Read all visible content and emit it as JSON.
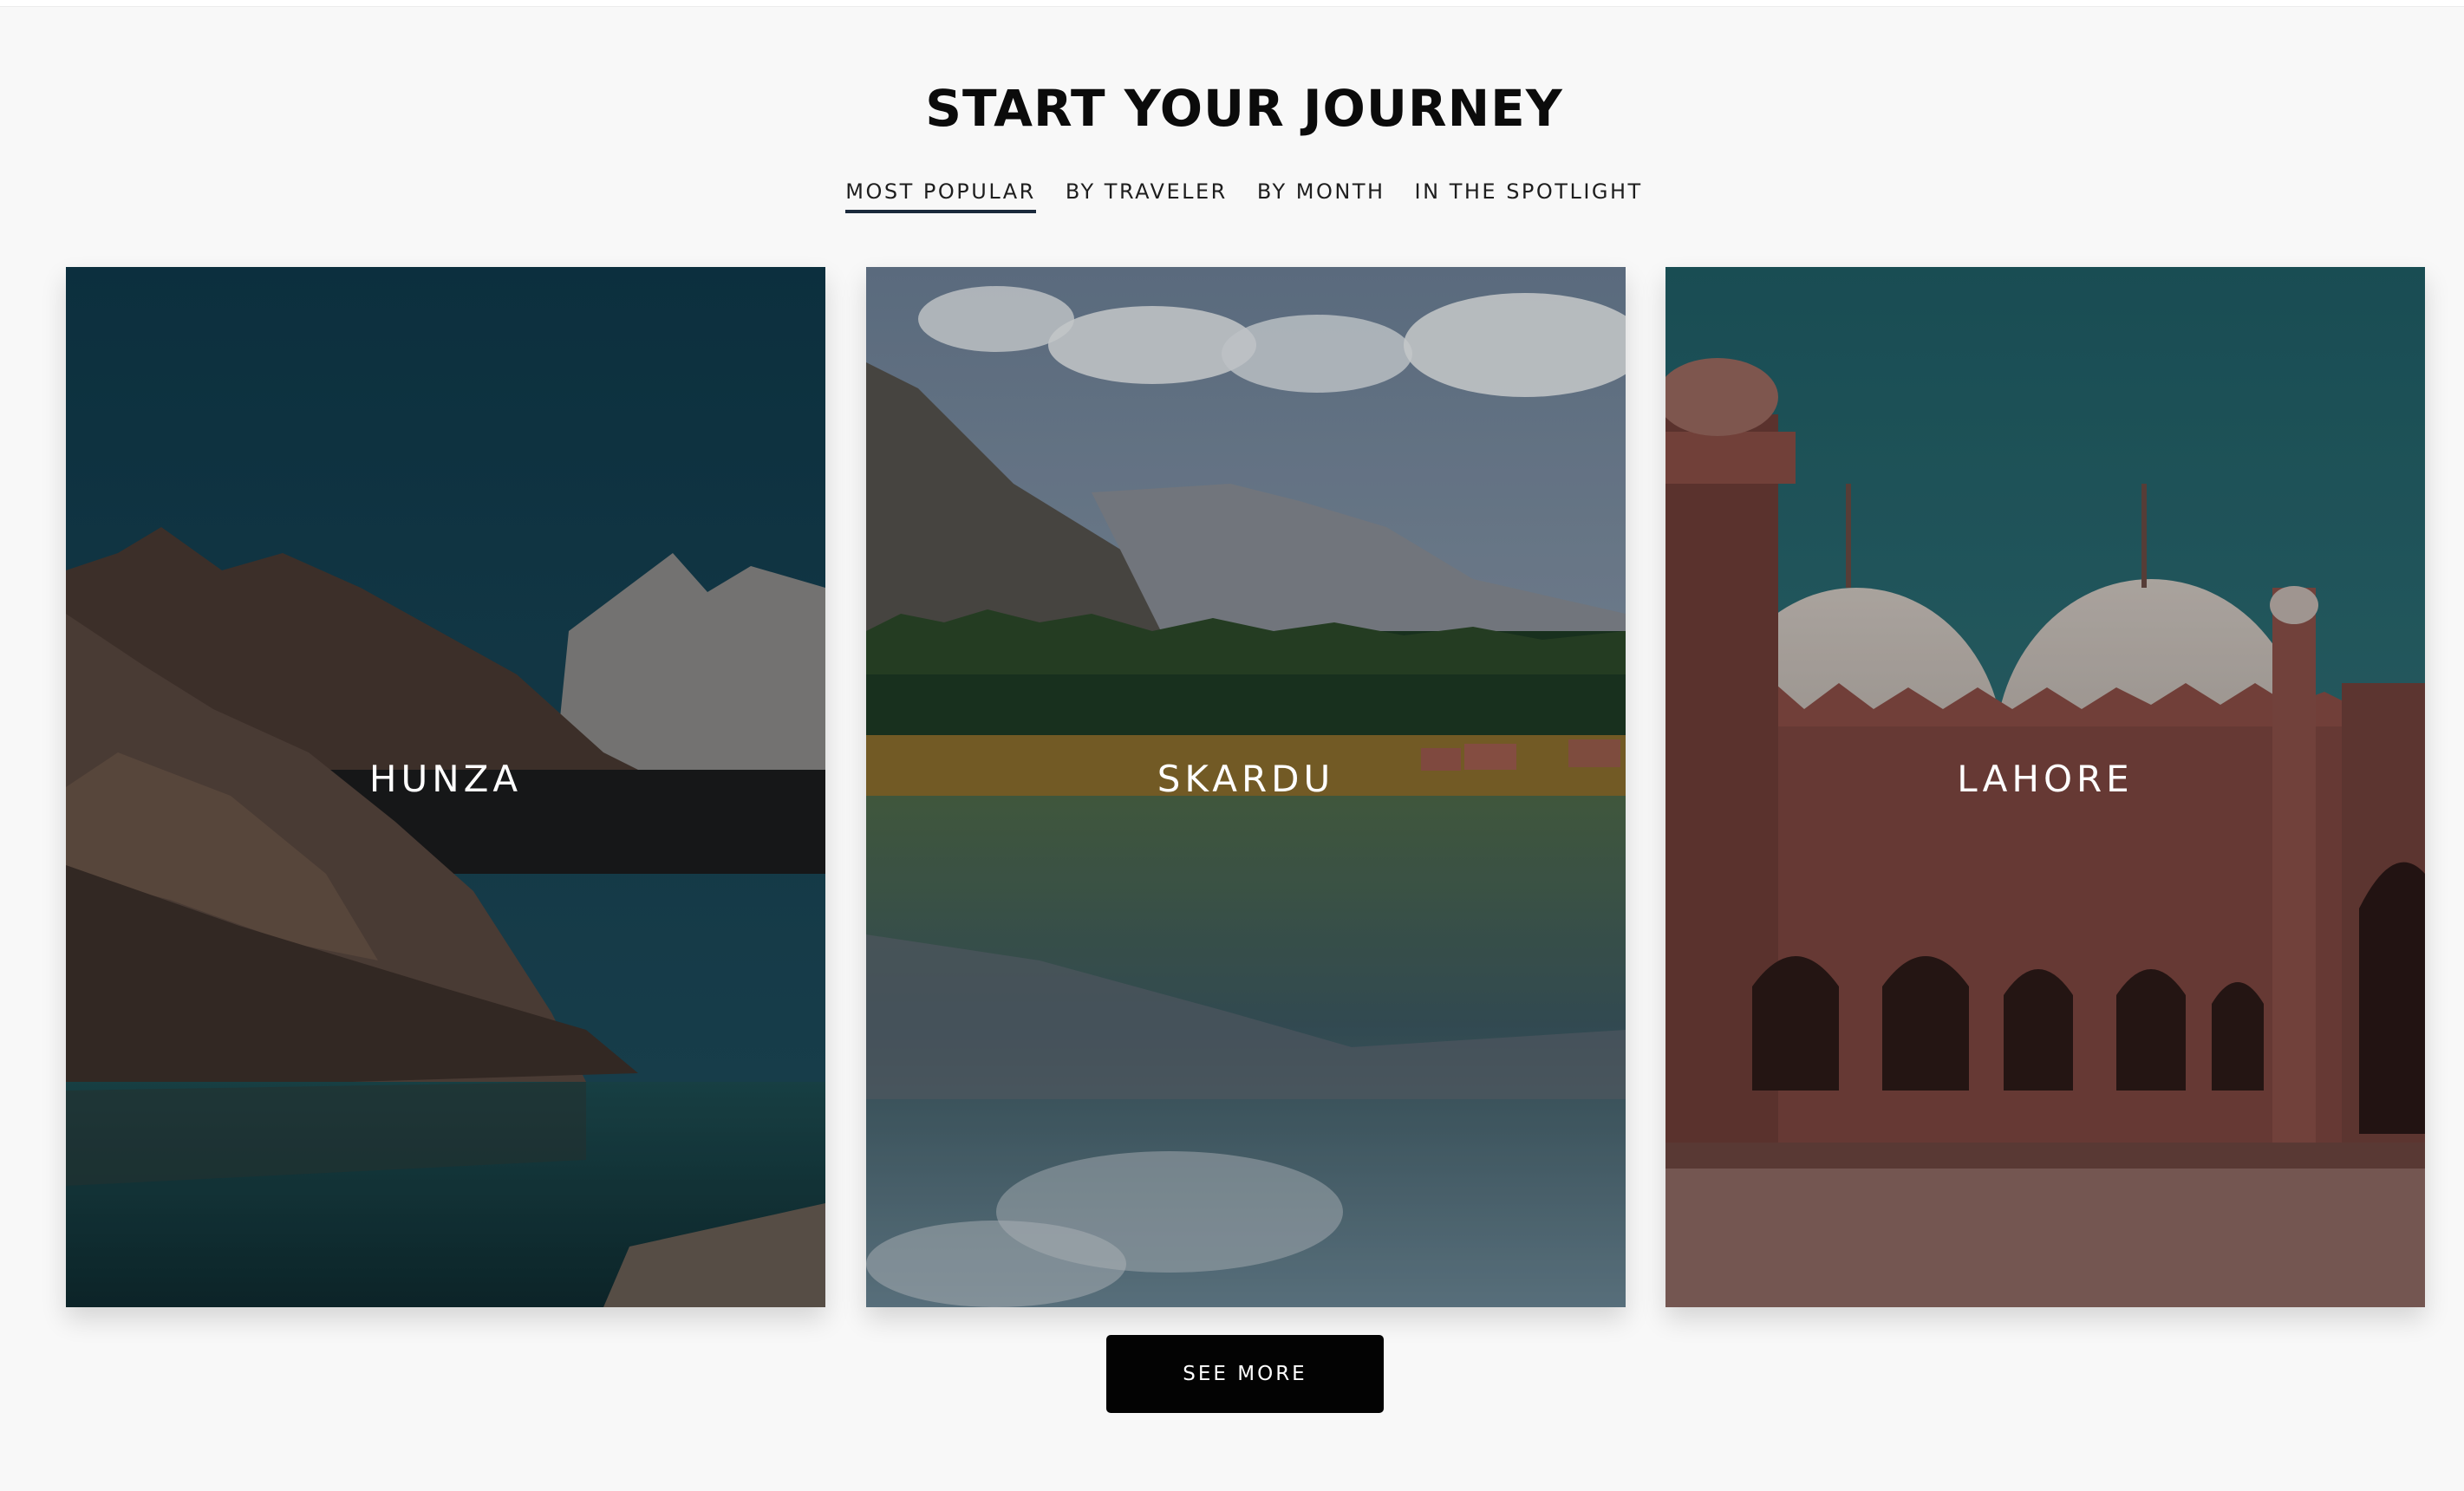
{
  "section": {
    "title": "START YOUR JOURNEY"
  },
  "tabs": [
    {
      "label": "MOST POPULAR",
      "active": true
    },
    {
      "label": "BY TRAVELER",
      "active": false
    },
    {
      "label": "BY MONTH",
      "active": false
    },
    {
      "label": "IN THE SPOTLIGHT",
      "active": false
    }
  ],
  "destinations": [
    {
      "name": "HUNZA"
    },
    {
      "name": "SKARDU"
    },
    {
      "name": "LAHORE"
    }
  ],
  "see_more_label": "SEE MORE",
  "colors": {
    "background": "#f8f8f8",
    "button": "#030303",
    "active_tab_underline": "#1b2a3c"
  }
}
